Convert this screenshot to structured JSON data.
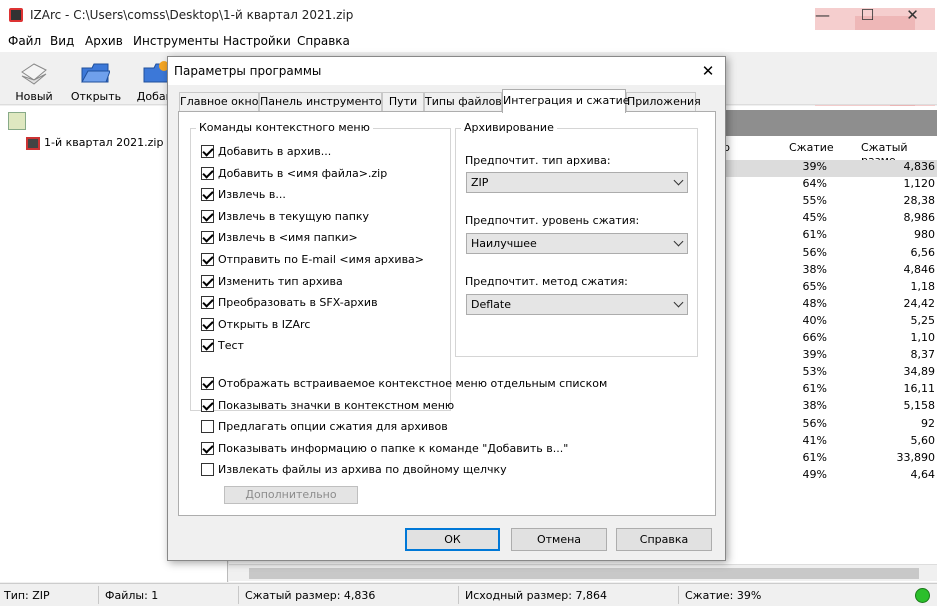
{
  "window": {
    "title": "IZArc - C:\\Users\\comss\\Desktop\\1-й квартал 2021.zip",
    "minimize": "—",
    "maximize": "☐",
    "close": "✕"
  },
  "menu": [
    "Файл",
    "Вид",
    "Архив",
    "Инструменты",
    "Настройки",
    "Справка"
  ],
  "toolbar": {
    "new_label": "Новый",
    "open_label": "Открыть",
    "add_label": "Добави"
  },
  "tree": {
    "item": "1-й квартал 2021.zip"
  },
  "list": {
    "col_packed_partial": "р",
    "col_ratio": "Сжатие",
    "col_compressed": "Сжатый разме",
    "rows": [
      {
        "ratio": "39%",
        "size": "4,836"
      },
      {
        "ratio": "64%",
        "size": "1,120"
      },
      {
        "ratio": "55%",
        "size": "28,38"
      },
      {
        "ratio": "45%",
        "size": "8,986"
      },
      {
        "ratio": "61%",
        "size": "980"
      },
      {
        "ratio": "56%",
        "size": "6,56"
      },
      {
        "ratio": "38%",
        "size": "4,846"
      },
      {
        "ratio": "65%",
        "size": "1,18"
      },
      {
        "ratio": "48%",
        "size": "24,42"
      },
      {
        "ratio": "40%",
        "size": "5,25"
      },
      {
        "ratio": "66%",
        "size": "1,10"
      },
      {
        "ratio": "39%",
        "size": "8,37"
      },
      {
        "ratio": "53%",
        "size": "34,89"
      },
      {
        "ratio": "61%",
        "size": "16,11"
      },
      {
        "ratio": "38%",
        "size": "5,158"
      },
      {
        "ratio": "56%",
        "size": "92"
      },
      {
        "ratio": "41%",
        "size": "5,60"
      },
      {
        "ratio": "61%",
        "size": "33,890"
      },
      {
        "ratio": "49%",
        "size": "4,64"
      }
    ]
  },
  "status": {
    "type": "Тип: ZIP",
    "files": "Файлы: 1",
    "packed": "Сжатый размер: 4,836",
    "original": "Исходный размер: 7,864",
    "ratio": "Сжатие: 39%",
    "led_color": "#2bbf2b"
  },
  "dialog": {
    "title": "Параметры программы",
    "close": "✕",
    "tabs": [
      "Главное окно",
      "Панель инструментов",
      "Пути",
      "Типы файлов",
      "Интеграция и сжатие",
      "Приложения"
    ],
    "active_tab": "Интеграция и сжатие",
    "context_group_title": "Команды контекстного меню",
    "context_items": [
      {
        "label": "Добавить в архив...",
        "checked": true
      },
      {
        "label": "Добавить в <имя файла>.zip",
        "checked": true
      },
      {
        "label": "Извлечь в...",
        "checked": true
      },
      {
        "label": "Извлечь в текущую папку",
        "checked": true
      },
      {
        "label": "Извлечь в <имя папки>",
        "checked": true
      },
      {
        "label": "Отправить по E-mail <имя архива>",
        "checked": true
      },
      {
        "label": "Изменить тип архива",
        "checked": true
      },
      {
        "label": "Преобразовать в SFX-архив",
        "checked": true
      },
      {
        "label": "Открыть в IZArc",
        "checked": true
      },
      {
        "label": "Тест",
        "checked": true
      }
    ],
    "archive_group_title": "Архивирование",
    "pref_type_label": "Предпочтит. тип архива:",
    "pref_type_value": "ZIP",
    "pref_level_label": "Предпочтит. уровень сжатия:",
    "pref_level_value": "Наилучшее",
    "pref_method_label": "Предпочтит. метод сжатия:",
    "pref_method_value": "Deflate",
    "bottom_options": [
      {
        "label": "Отображать встраиваемое контекстное меню отдельным списком",
        "checked": true
      },
      {
        "label": "Показывать значки в контекстном меню",
        "checked": true
      },
      {
        "label": "Предлагать опции сжатия для архивов",
        "checked": false
      },
      {
        "label": "Показывать информацию о папке к команде \"Добавить в...\"",
        "checked": true
      },
      {
        "label": "Извлекать файлы из архива по двойному щелчку",
        "checked": false
      }
    ],
    "advanced_label": "Дополнительно",
    "ok_label": "ОК",
    "cancel_label": "Отмена",
    "help_label": "Справка"
  }
}
